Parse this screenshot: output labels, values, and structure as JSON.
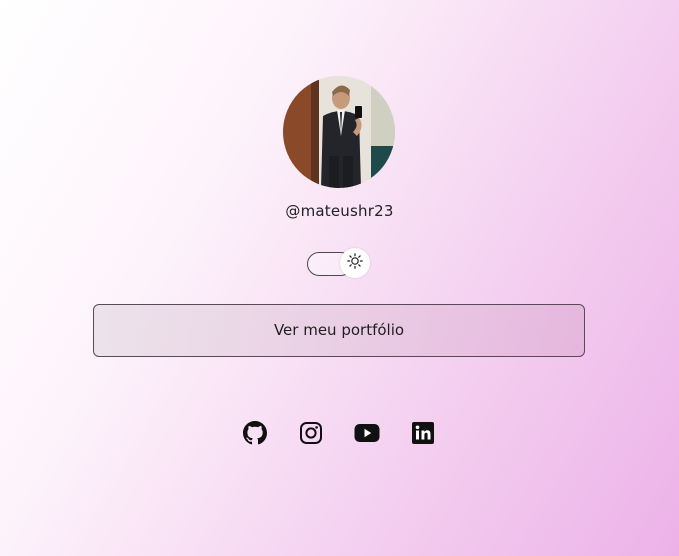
{
  "profile": {
    "username": "@mateushr23",
    "avatar_icon": "profile-photo"
  },
  "theme_toggle": {
    "state": "light",
    "icon": "sun-icon"
  },
  "portfolio_button": {
    "label": "Ver meu portfólio"
  },
  "social_links": [
    {
      "name": "GitHub",
      "icon": "github-icon"
    },
    {
      "name": "Instagram",
      "icon": "instagram-icon"
    },
    {
      "name": "YouTube",
      "icon": "youtube-icon"
    },
    {
      "name": "LinkedIn",
      "icon": "linkedin-icon"
    }
  ],
  "colors": {
    "background_start": "#ffffff",
    "background_end": "#ecb2e8",
    "text": "#222222",
    "icon": "#111111"
  }
}
